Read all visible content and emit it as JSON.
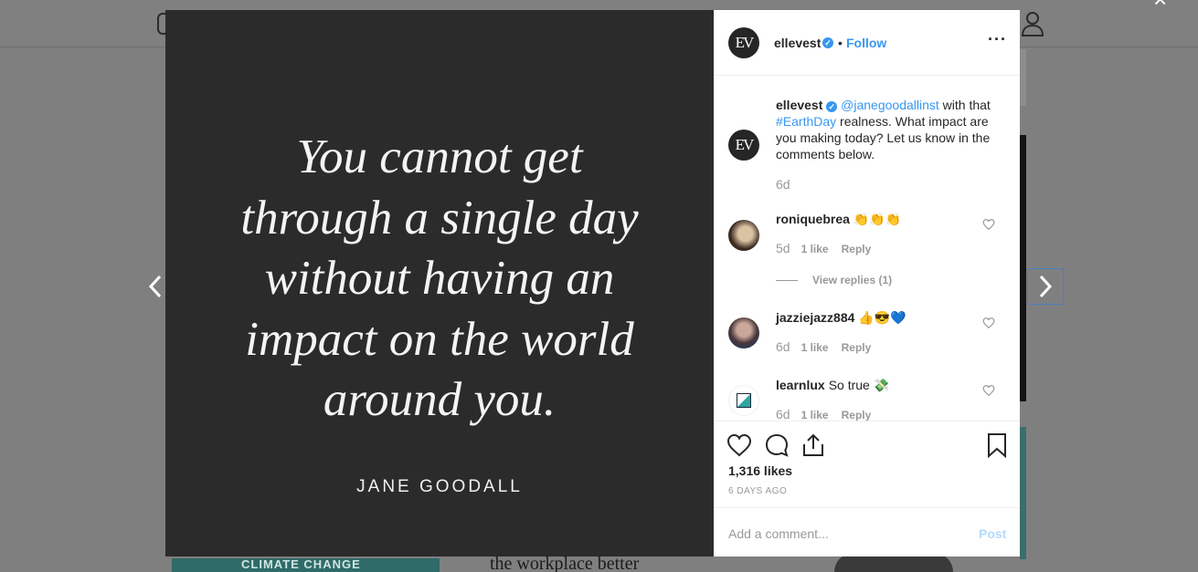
{
  "background": {
    "tile_texts": [
      "CLIMATE CHANGE",
      "the workplace better"
    ]
  },
  "media": {
    "quote_lines": [
      "You cannot get",
      "through a single day",
      "without having an",
      "impact on the world",
      "around you."
    ],
    "author": "JANE GOODALL",
    "background_color": "#2b2b2b"
  },
  "header": {
    "avatar_text": "EV",
    "username": "ellevest",
    "verified_mark": "✓",
    "separator": "•",
    "follow_label": "Follow",
    "more_label": "···"
  },
  "caption": {
    "username": "ellevest",
    "mention": "@janegoodallinst",
    "text_part1": " with that ",
    "hashtag": "#EarthDay",
    "text_part2": " realness. What impact are you making today? Let us know in the comments below.",
    "time": "6d"
  },
  "comments": [
    {
      "username": "roniquebrea",
      "text": "👏👏👏",
      "time": "5d",
      "likes": "1 like",
      "reply_label": "Reply",
      "view_replies": "View replies (1)"
    },
    {
      "username": "jazziejazz884",
      "text": "👍😎💙",
      "time": "6d",
      "likes": "1 like",
      "reply_label": "Reply"
    },
    {
      "username": "learnlux",
      "text": "So true 💸",
      "time": "6d",
      "likes": "1 like",
      "reply_label": "Reply"
    }
  ],
  "actions": {
    "likes": "1,316 likes",
    "date": "6 DAYS AGO",
    "icons": [
      "heart-icon",
      "comment-icon",
      "share-icon",
      "bookmark-icon"
    ]
  },
  "add_comment": {
    "placeholder": "Add a comment...",
    "post_label": "Post"
  },
  "colors": {
    "accent": "#3897f0",
    "muted": "#999999"
  }
}
